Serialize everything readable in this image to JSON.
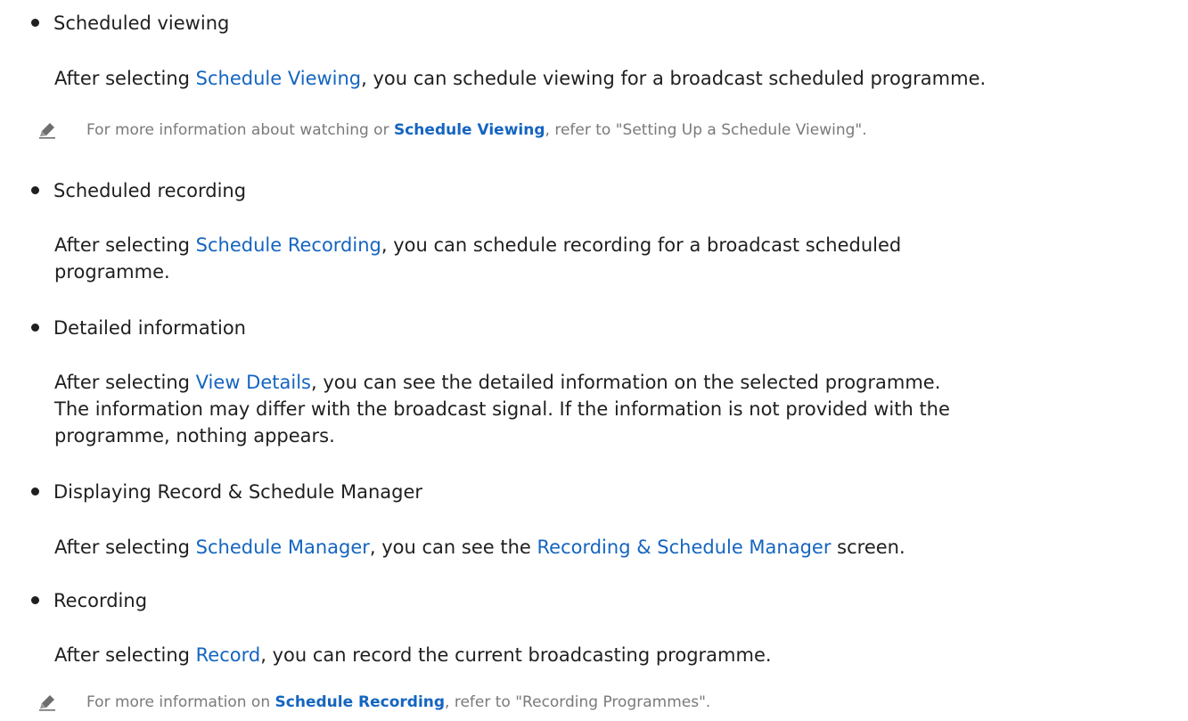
{
  "items": [
    {
      "title": "Scheduled viewing",
      "pre": "After selecting ",
      "link": "Schedule Viewing",
      "post": ", you can schedule viewing for a broadcast scheduled programme.",
      "note": {
        "pre": "For more information about watching or ",
        "link": "Schedule Viewing",
        "post": ", refer to \"Setting Up a Schedule Viewing\"."
      }
    },
    {
      "title": "Scheduled recording",
      "pre": "After selecting ",
      "link": "Schedule Recording",
      "post_line1": ", you can schedule recording for a broadcast scheduled",
      "post_line2": "programme."
    },
    {
      "title": "Detailed information",
      "pre": "After selecting ",
      "link": "View Details",
      "post_line1": ", you can see the detailed information on the selected programme.",
      "line2": "The information may differ with the broadcast signal. If the information is not provided with the",
      "line3": "programme, nothing appears."
    },
    {
      "title": "Displaying Record & Schedule Manager",
      "pre": "After selecting ",
      "link": "Schedule Manager",
      "mid": ", you can see the ",
      "link2": "Recording & Schedule Manager",
      "post": " screen."
    },
    {
      "title": "Recording",
      "pre": "After selecting ",
      "link": "Record",
      "post": ", you can record the current broadcasting programme.",
      "note": {
        "pre": "For more information on ",
        "link": "Schedule Recording",
        "post": ", refer to \"Recording Programmes\"."
      }
    }
  ],
  "icons": {
    "note": "pencil-note-icon"
  },
  "colors": {
    "link": "#1565c0",
    "text": "#1f1f1f",
    "note_text": "#7a7a7a"
  }
}
